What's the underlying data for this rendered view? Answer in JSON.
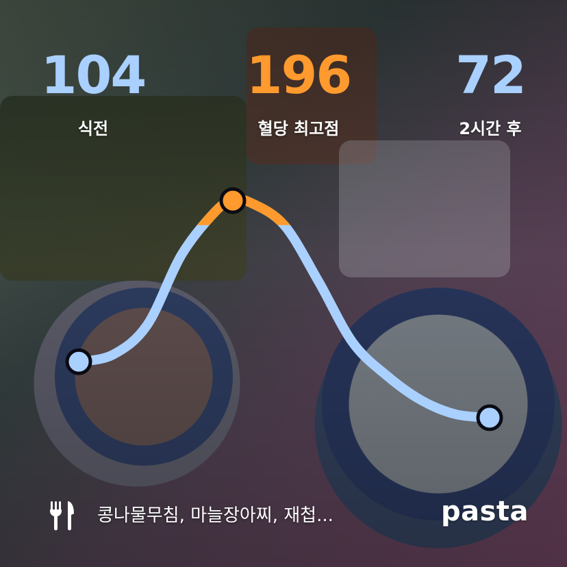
{
  "colors": {
    "before": "#a9d0ff",
    "peak": "#ff9a2e",
    "after": "#a9d0ff",
    "line": "#a9d0ff",
    "line_peak": "#ff9a2e"
  },
  "stats": [
    {
      "value": "104",
      "label": "식전"
    },
    {
      "value": "196",
      "label": "혈당 최고점"
    },
    {
      "value": "72",
      "label": "2시간 후"
    }
  ],
  "footer": {
    "icon": "fork-knife-icon",
    "meal": "콩나물무침, 마늘장아찌, 재첩...",
    "brand": "pasta"
  },
  "chart_data": {
    "type": "line",
    "series": [
      {
        "points": [
          {
            "t": 0,
            "v": 104
          },
          {
            "t": 10,
            "v": 108
          },
          {
            "t": 20,
            "v": 125
          },
          {
            "t": 30,
            "v": 165
          },
          {
            "t": 40,
            "v": 190
          },
          {
            "t": 45,
            "v": 196
          },
          {
            "t": 50,
            "v": 195
          },
          {
            "t": 60,
            "v": 182
          },
          {
            "t": 70,
            "v": 150
          },
          {
            "t": 80,
            "v": 115
          },
          {
            "t": 90,
            "v": 96
          },
          {
            "t": 100,
            "v": 82
          },
          {
            "t": 110,
            "v": 74
          },
          {
            "t": 120,
            "v": 72
          }
        ]
      }
    ],
    "markers": [
      {
        "t": 0,
        "v": 104
      },
      {
        "t": 45,
        "v": 196
      },
      {
        "t": 120,
        "v": 72
      }
    ],
    "highlight_above": 182
  }
}
